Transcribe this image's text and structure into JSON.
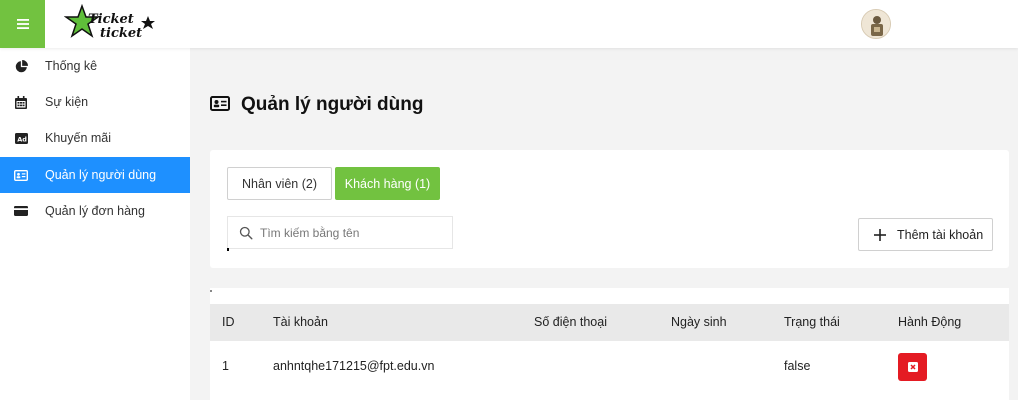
{
  "header": {
    "logo_text": "Ticket ticket",
    "menu_icon": "hamburger-icon",
    "avatar_icon": "user-avatar"
  },
  "sidebar": {
    "items": [
      {
        "label": "Thống kê",
        "icon": "pie-chart-icon",
        "active": false
      },
      {
        "label": "Sự kiện",
        "icon": "calendar-icon",
        "active": false
      },
      {
        "label": "Khuyến mãi",
        "icon": "ad-icon",
        "active": false
      },
      {
        "label": "Quản lý người dùng",
        "icon": "id-card-icon",
        "active": true
      },
      {
        "label": "Quản lý đơn hàng",
        "icon": "credit-card-icon",
        "active": false
      }
    ]
  },
  "main": {
    "title": "Quản lý người dùng",
    "tabs": [
      {
        "label": "Nhân viên (2)",
        "active": false
      },
      {
        "label": "Khách hàng (1)",
        "active": true
      }
    ],
    "search": {
      "placeholder": "Tìm kiếm bằng tên",
      "value": ""
    },
    "add_button": "Thêm tài khoản",
    "table": {
      "columns": [
        "ID",
        "Tài khoản",
        "Số điện thoại",
        "Ngày sinh",
        "Trạng thái",
        "Hành Động"
      ],
      "rows": [
        {
          "id": "1",
          "account": "anhntqhe171215@fpt.edu.vn",
          "phone": "",
          "dob": "",
          "status": "false"
        }
      ]
    }
  },
  "colors": {
    "accent_green": "#72c240",
    "active_blue": "#1e90ff",
    "danger_red": "#e41b23"
  }
}
